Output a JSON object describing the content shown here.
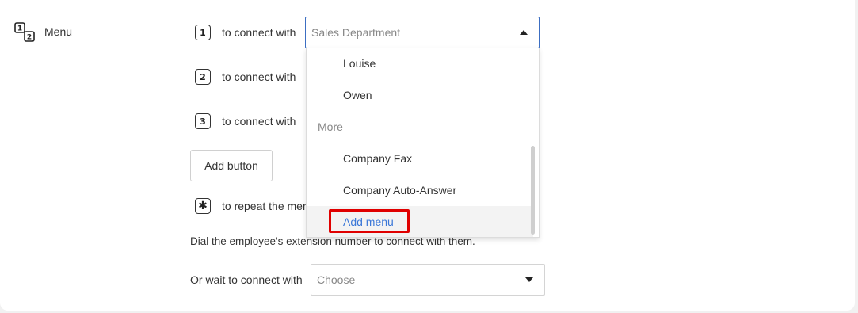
{
  "menu": {
    "label": "Menu",
    "icon": "numbered-menu-icon"
  },
  "rows": [
    {
      "key": "1",
      "text": "to connect with"
    },
    {
      "key": "2",
      "text": "to connect with"
    },
    {
      "key": "3",
      "text": "to connect with"
    }
  ],
  "repeat_row": {
    "key": "✱",
    "text": "to repeat the menu"
  },
  "primary_select": {
    "value": "Sales Department"
  },
  "add_button_label": "Add button",
  "info_text": "Dial the employee's extension number to connect with them.",
  "wait": {
    "label": "Or wait to connect with",
    "placeholder": "Choose"
  },
  "dropdown": {
    "items": [
      {
        "type": "option",
        "label": "Louise"
      },
      {
        "type": "option",
        "label": "Owen"
      },
      {
        "type": "group",
        "label": "More"
      },
      {
        "type": "option",
        "label": "Company Fax"
      },
      {
        "type": "option",
        "label": "Company Auto-Answer"
      },
      {
        "type": "action",
        "label": "Add menu"
      }
    ]
  },
  "colors": {
    "accent": "#3c6ec2",
    "link": "#3c78d8",
    "highlight": "#e00000"
  }
}
